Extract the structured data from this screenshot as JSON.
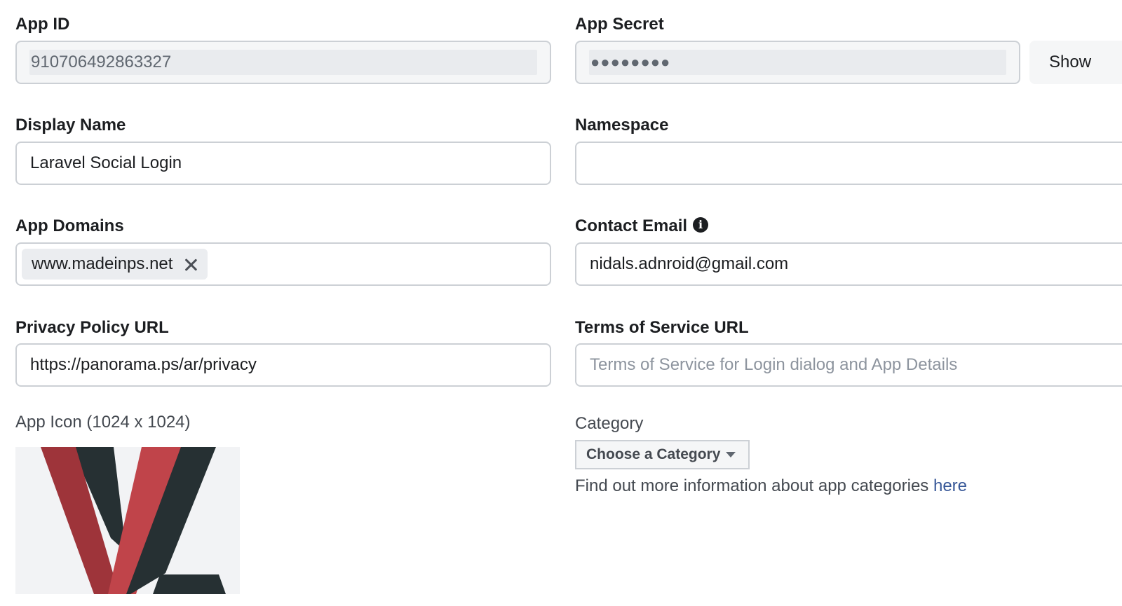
{
  "app_id": {
    "label": "App ID",
    "value": "910706492863327"
  },
  "app_secret": {
    "label": "App Secret",
    "value": "●●●●●●●●",
    "show_button": "Show"
  },
  "display_name": {
    "label": "Display Name",
    "value": "Laravel Social Login"
  },
  "namespace": {
    "label": "Namespace",
    "value": ""
  },
  "app_domains": {
    "label": "App Domains",
    "tags": [
      "www.madeinps.net"
    ]
  },
  "contact_email": {
    "label": "Contact Email",
    "info_icon": "info-icon",
    "value": "nidals.adnroid@gmail.com"
  },
  "privacy_policy": {
    "label": "Privacy Policy URL",
    "value": "https://panorama.ps/ar/privacy"
  },
  "terms_of_service": {
    "label": "Terms of Service URL",
    "placeholder": "Terms of Service for Login dialog and App Details",
    "value": ""
  },
  "app_icon": {
    "label": "App Icon (1024 x 1024)",
    "colors": {
      "red": "#c0444a",
      "dark_red": "#9e343a",
      "dark": "#263033",
      "background": "#f2f3f5"
    }
  },
  "category": {
    "label": "Category",
    "selected": "Choose a Category",
    "info_text": "Find out more information about app categories ",
    "info_link": "here"
  },
  "colors": {
    "link": "#385898",
    "border": "#ccd0d5",
    "text": "#1c1e21"
  }
}
